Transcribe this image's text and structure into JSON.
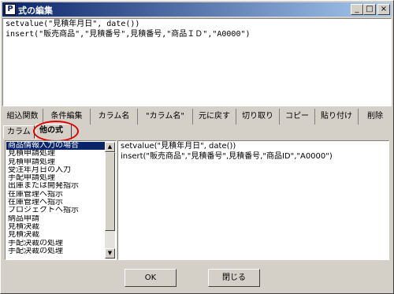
{
  "window": {
    "title": "式の編集",
    "controls": {
      "minimize": "_",
      "maximize": "□",
      "close": "×"
    }
  },
  "editor": {
    "lines": [
      "setvalue(\"見積年月日\", date())",
      "insert(\"販売商品\",\"見積番号\",見積番号,\"商品ＩＤ\",\"A0000\")"
    ]
  },
  "toolbar": {
    "items": [
      "組込関数",
      "条件編集",
      "カラム名",
      "\"カラム名\"",
      "元に戻す",
      "切り取り",
      "コピー",
      "貼り付け",
      "削除"
    ]
  },
  "tabs": {
    "column": "カラム",
    "other": "他の式"
  },
  "list": {
    "items": [
      "商品情報入力の場合",
      "見積申請処理",
      "見積申請処理",
      "受注年月日の入力",
      "手配申請処理",
      "出庫または開発指示",
      "在庫管理へ指示",
      "在庫管理へ指示",
      "プロジェクトへ指示",
      "納品申請",
      "見積決裁",
      "見積決裁",
      "手配決裁の処理",
      "手配決裁の処理"
    ],
    "selected_index": 0
  },
  "preview": {
    "lines": [
      "setvalue(\"見積年月日\", date())",
      "insert(\"販売商品\",\"見積番号\",見積番号,\"商品ID\",\"A0000\")"
    ]
  },
  "buttons": {
    "ok": "OK",
    "close": "閉じる"
  }
}
